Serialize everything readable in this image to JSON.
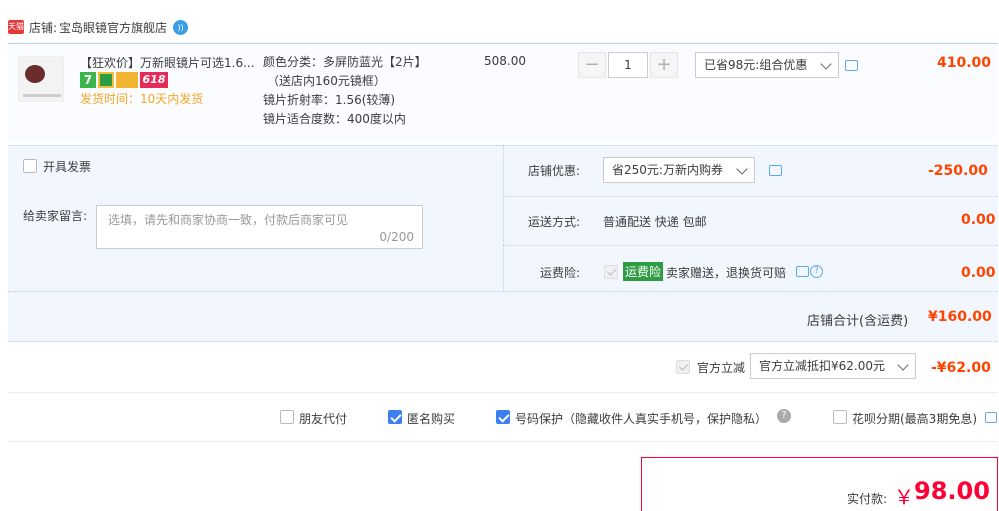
{
  "shop": {
    "label": "店铺:",
    "name": "宝岛眼镜官方旗舰店",
    "tmall_badge": "天猫"
  },
  "item": {
    "title": "【狂欢价】万新眼镜片可选1.6...",
    "badge_618": "618",
    "badge_7": "7",
    "ship_time": "发货时间：10天内发货",
    "attrs": [
      "颜色分类：多屏防蓝光【2片】",
      "（送店内160元镜框）",
      "镜片折射率：1.56(较薄)",
      "镜片适合度数：400度以内"
    ],
    "unit_price": "508.00",
    "qty": "1",
    "qty_minus": "−",
    "qty_plus": "+",
    "promo_select": "已省98元:组合优惠",
    "subtotal": "410.00"
  },
  "invoice": {
    "label": "开具发票"
  },
  "message": {
    "label": "给卖家留言:",
    "placeholder": "选填，请先和商家协商一致，付款后商家可见",
    "counter": "0/200"
  },
  "store_discount": {
    "label": "店铺优惠:",
    "select": "省250元:万新内购券",
    "amount": "-250.00"
  },
  "shipping": {
    "label": "运送方式:",
    "value": "普通配送 快递 包邮",
    "amount": "0.00"
  },
  "insurance": {
    "label": "运费险:",
    "tag": "运费险",
    "desc": "卖家赠送，退换货可赔",
    "amount": "0.00"
  },
  "store_total": {
    "label": "店铺合计(含运费)",
    "amount": "¥160.00"
  },
  "official": {
    "label": "官方立减",
    "select": "官方立减抵扣¥62.00元",
    "amount": "-¥62.00"
  },
  "options": [
    {
      "label": "朋友代付",
      "checked": false
    },
    {
      "label": "匿名购买",
      "checked": true
    },
    {
      "label": "号码保护（隐藏收件人真实手机号，保护隐私）",
      "checked": true
    },
    {
      "label": "花呗分期(最高3期免息)",
      "checked": false
    }
  ],
  "pay": {
    "label": "实付款:",
    "currency": "￥",
    "amount": "98.00"
  },
  "colors": {
    "accent_red": "#ff4400",
    "panel_blue": "#f2f7ff",
    "checkbox_blue": "#3d7ff2"
  }
}
